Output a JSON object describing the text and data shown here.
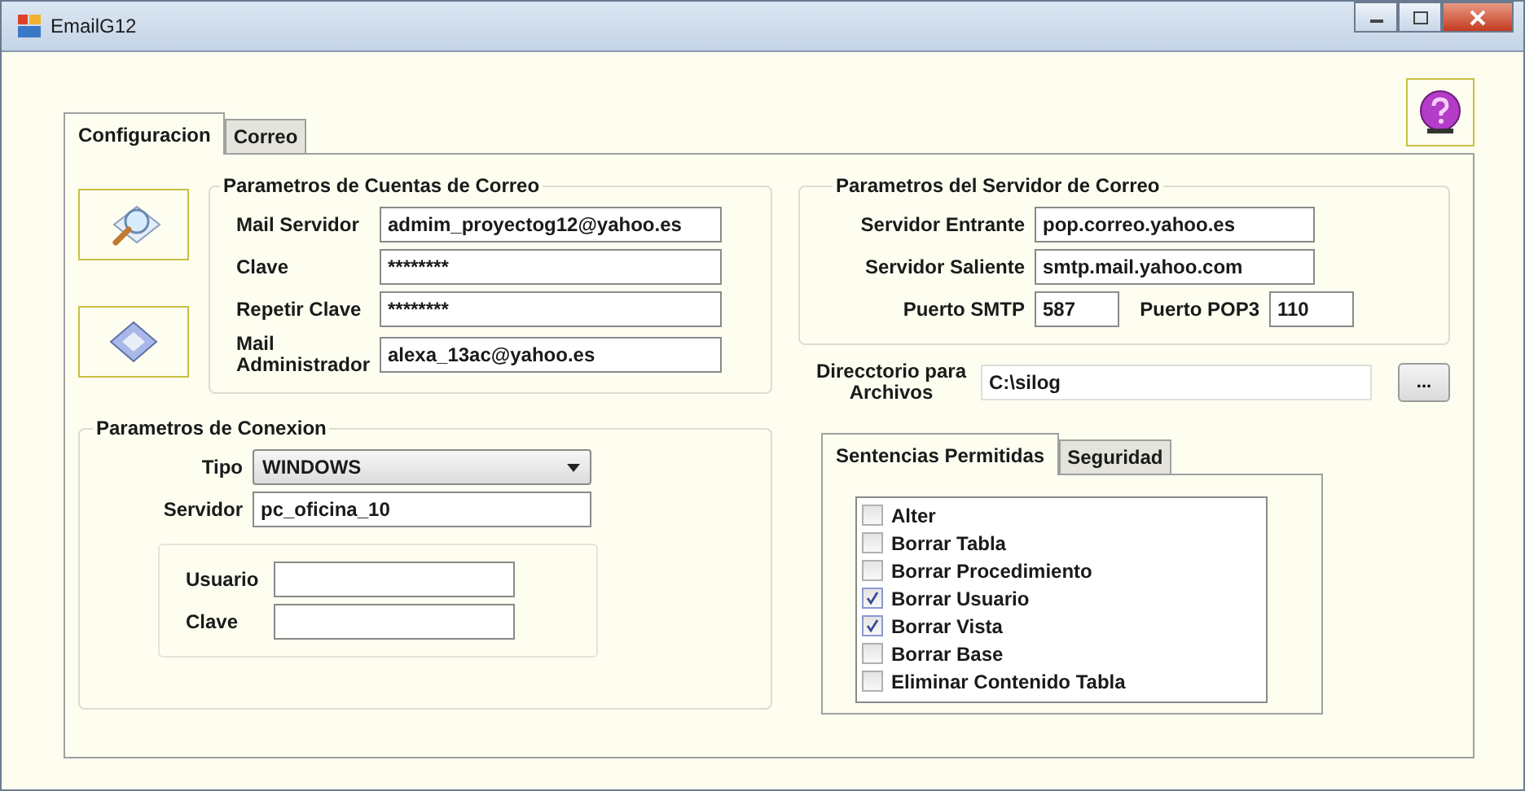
{
  "window": {
    "title": "EmailG12"
  },
  "tabs": [
    {
      "label": "Configuracion",
      "selected": true
    },
    {
      "label": "Correo",
      "selected": false
    }
  ],
  "account_group": {
    "title": "Parametros de Cuentas de Correo",
    "fields": [
      {
        "label": "Mail Servidor",
        "value": "admim_proyectog12@yahoo.es"
      },
      {
        "label": "Clave",
        "value": "********"
      },
      {
        "label": "Repetir Clave",
        "value": "********"
      },
      {
        "label": "Mail Administrador",
        "value": "alexa_13ac@yahoo.es"
      }
    ]
  },
  "server_group": {
    "title": "Parametros del  Servidor de Correo",
    "incoming": {
      "label": "Servidor Entrante",
      "value": "pop.correo.yahoo.es"
    },
    "outgoing": {
      "label": "Servidor Saliente",
      "value": "smtp.mail.yahoo.com"
    },
    "smtp_port": {
      "label": "Puerto SMTP",
      "value": "587"
    },
    "pop3_port": {
      "label": "Puerto POP3",
      "value": "110"
    }
  },
  "directory": {
    "label": "Direcctorio para Archivos",
    "value": "C:\\silog",
    "browse_button": "..."
  },
  "connection_group": {
    "title": "Parametros de Conexion",
    "type": {
      "label": "Tipo",
      "value": "WINDOWS"
    },
    "server": {
      "label": "Servidor",
      "value": "pc_oficina_10"
    },
    "credentials": [
      {
        "label": "Usuario"
      },
      {
        "label": "Clave"
      }
    ]
  },
  "permission_tabs": [
    {
      "label": "Sentencias Permitidas",
      "selected": true
    },
    {
      "label": "Seguridad",
      "selected": false
    }
  ],
  "statements": [
    {
      "label": "Alter",
      "checked": false
    },
    {
      "label": "Borrar Tabla",
      "checked": false
    },
    {
      "label": "Borrar Procedimiento",
      "checked": false
    },
    {
      "label": "Borrar Usuario",
      "checked": true
    },
    {
      "label": "Borrar Vista",
      "checked": true
    },
    {
      "label": "Borrar Base",
      "checked": false
    },
    {
      "label": "Eliminar Contenido Tabla",
      "checked": false
    }
  ]
}
